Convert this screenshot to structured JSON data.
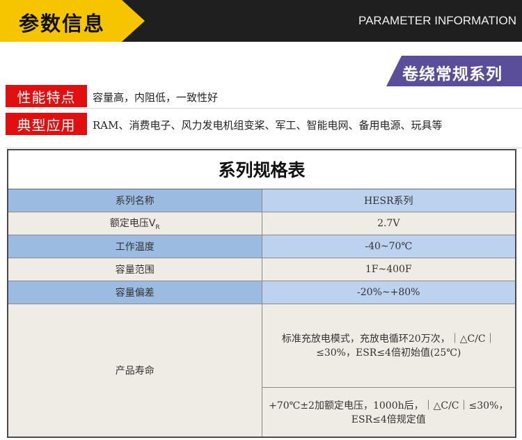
{
  "header": {
    "title": "参数信息",
    "subtitle": "PARAMETER INFORMATION"
  },
  "series_banner": "卷绕常规系列",
  "features": [
    {
      "tag": "性能特点",
      "text": "容量高，内阻低，一致性好"
    },
    {
      "tag": "典型应用",
      "text": "RAM、消费电子、风力发电机组变桨、军工、智能电网、备用电源、玩具等"
    }
  ],
  "spec_table": {
    "title": "系列规格表",
    "rows": [
      {
        "label": "系列名称",
        "value": "HESR系列"
      },
      {
        "label": "额定电压V",
        "label_sub": "R",
        "value": "2.7V"
      },
      {
        "label": "工作温度",
        "value": "-40~70℃"
      },
      {
        "label": "容量范围",
        "value": "1F~400F"
      },
      {
        "label": "容量偏差",
        "value": "-20%~+80%"
      }
    ],
    "life": {
      "label": "产品寿命",
      "values": [
        "标准充放电模式，充放电循环20万次，｜△C/C｜≤30%，ESR≤4倍初始值(25℃)",
        "+70℃±2加额定电压，1000h后，｜△C/C｜≤30%，ESR≤4倍规定值"
      ]
    }
  },
  "colors": {
    "header_bg": "#1f1f1f",
    "header_accent": "#f6c500",
    "banner": "#5a4d99",
    "tag": "#e01010",
    "row_blue": "#9bbce0",
    "row_beige": "#efece6"
  }
}
